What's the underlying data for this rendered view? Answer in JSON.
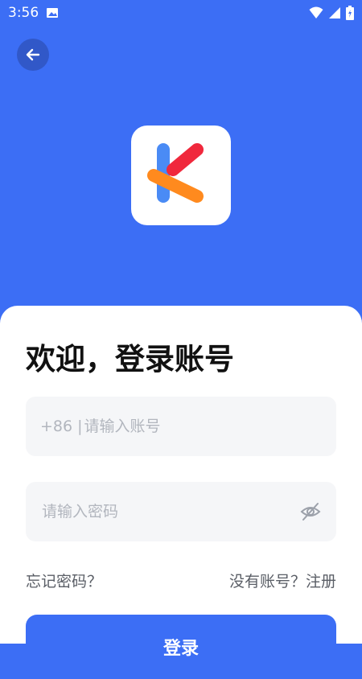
{
  "status_bar": {
    "time": "3:56"
  },
  "account_field": {
    "prefix": "+86 | ",
    "placeholder": "请输入账号"
  },
  "password_field": {
    "placeholder": "请输入密码"
  },
  "title": "欢迎，登录账号",
  "links": {
    "forgot_password": "忘记密码？",
    "register": "没有账号？注册"
  },
  "login_button": "登录",
  "colors": {
    "brand_blue": "#3C6EF5",
    "logo_red": "#F0283C",
    "logo_blue": "#4A8BF5",
    "logo_orange": "#FF8A1E"
  },
  "icons": [
    "image-icon",
    "wifi-icon",
    "signal-icon",
    "battery-icon",
    "back-arrow-icon",
    "app-logo-icon",
    "eye-off-icon"
  ]
}
